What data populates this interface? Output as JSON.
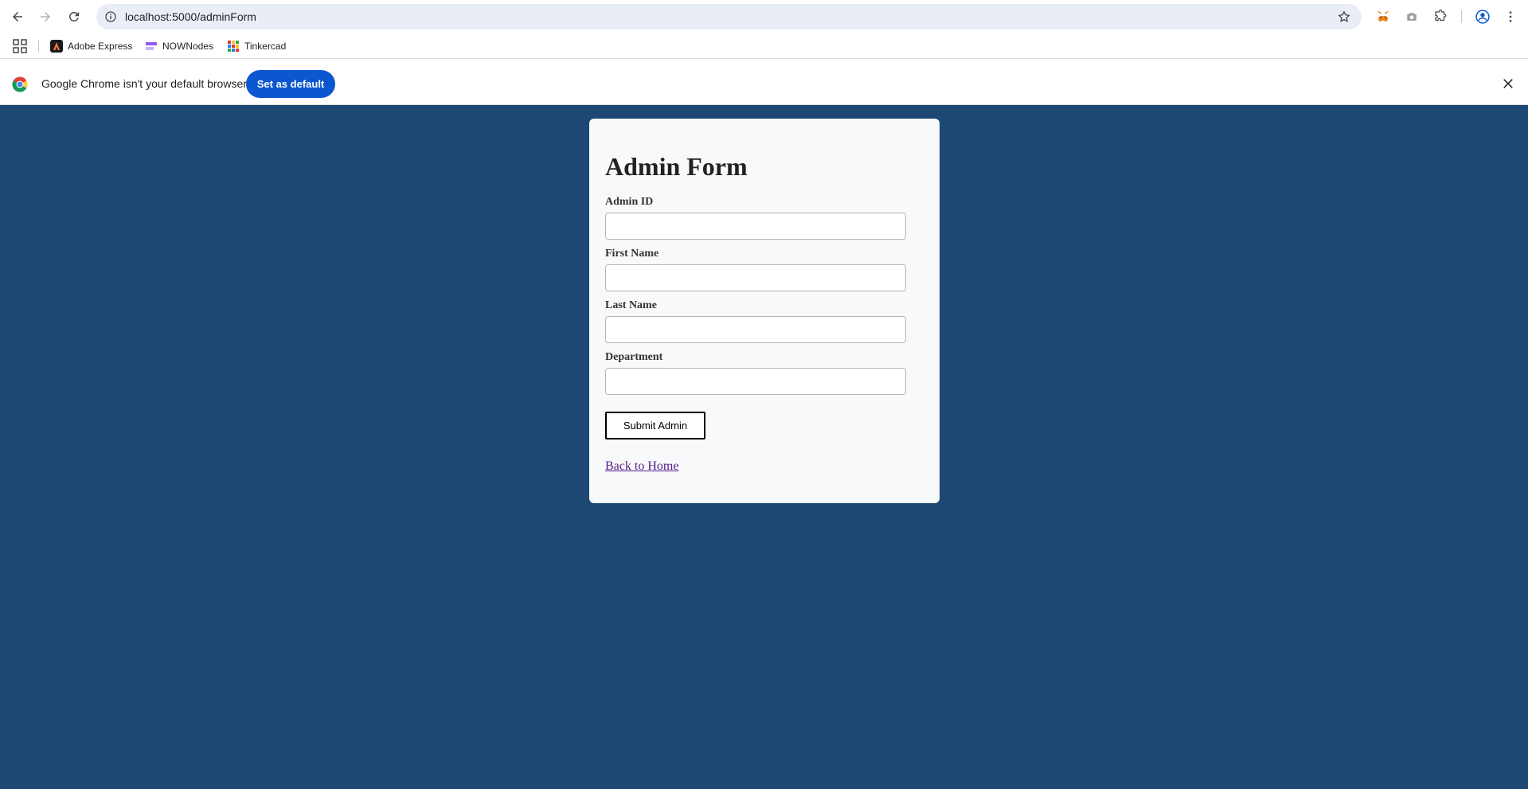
{
  "browser": {
    "url": "localhost:5000/adminForm",
    "bookmarks": [
      {
        "label": "Adobe Express",
        "icon": "adobe-express-icon"
      },
      {
        "label": "NOWNodes",
        "icon": "nownodes-icon"
      },
      {
        "label": "Tinkercad",
        "icon": "tinkercad-icon"
      }
    ],
    "infobar": {
      "message": "Google Chrome isn't your default browser",
      "button_label": "Set as default"
    }
  },
  "form": {
    "title": "Admin Form",
    "fields": [
      {
        "label": "Admin ID",
        "value": ""
      },
      {
        "label": "First Name",
        "value": ""
      },
      {
        "label": "Last Name",
        "value": ""
      },
      {
        "label": "Department",
        "value": ""
      }
    ],
    "submit_label": "Submit Admin",
    "back_link": "Back to Home"
  },
  "colors": {
    "page_background": "#1d4873",
    "card_background": "#f8f9fb",
    "accent_button": "#0b57d0",
    "visited_link": "#551a8b"
  }
}
